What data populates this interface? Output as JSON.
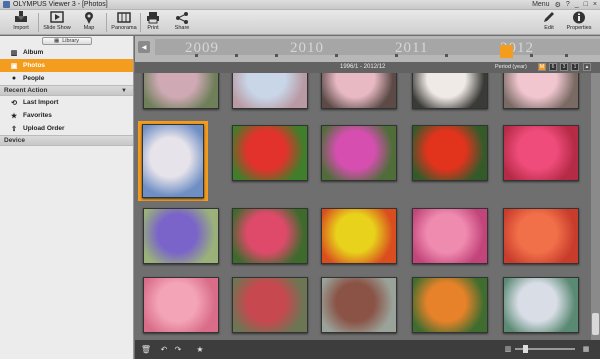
{
  "window": {
    "title": "OLYMPUS Viewer 3 - [Photos]",
    "menu_label": "Menu",
    "controls": [
      "⚙",
      "?",
      "_",
      "□",
      "×"
    ]
  },
  "toolbar": {
    "import": "Import",
    "slideshow": "Slide Show",
    "map": "Map",
    "panorama": "Panorama",
    "print": "Print",
    "share": "Share",
    "edit": "Edit",
    "properties": "Properties"
  },
  "library": {
    "button_label": "Library",
    "icon": "grid-icon"
  },
  "sidebar": {
    "items": [
      {
        "label": "Album",
        "icon": "album-icon",
        "selected": false
      },
      {
        "label": "Photos",
        "icon": "photos-icon",
        "selected": true
      },
      {
        "label": "People",
        "icon": "people-icon",
        "selected": false
      }
    ],
    "recent_header": "Recent Action",
    "recent_items": [
      {
        "label": "Last Import",
        "icon": "import-icon"
      },
      {
        "label": "Favorites",
        "icon": "star-icon"
      },
      {
        "label": "Upload Order",
        "icon": "upload-icon"
      }
    ],
    "device_header": "Device"
  },
  "timeline": {
    "years": [
      "2009",
      "2010",
      "2011",
      "2012"
    ],
    "range": "1996/1 - 2012/12",
    "period_label": "Period (year)",
    "period_buttons": [
      "M",
      "6",
      "3",
      "1"
    ],
    "active_button": 0
  },
  "photos": [
    {
      "subject": "cherry blossoms",
      "colors": [
        "#cfa9b4",
        "#6f7f5a"
      ]
    },
    {
      "subject": "cherry blossoms sky",
      "colors": [
        "#c8d6e8",
        "#b99aa4"
      ]
    },
    {
      "subject": "pink blossoms",
      "colors": [
        "#e8b9c3",
        "#5b4a46"
      ]
    },
    {
      "subject": "white blossoms",
      "colors": [
        "#f0eae6",
        "#3a3a36"
      ]
    },
    {
      "subject": "pink cherry",
      "colors": [
        "#f1c6cf",
        "#7a6a64"
      ]
    },
    {
      "subject": "tree in bloom",
      "colors": [
        "#e7e3ea",
        "#6f8fc4"
      ]
    },
    {
      "subject": "red tulip",
      "colors": [
        "#e3322b",
        "#3f7e2a"
      ]
    },
    {
      "subject": "pink orchid",
      "colors": [
        "#d64fb0",
        "#4e6d38"
      ]
    },
    {
      "subject": "red rose",
      "colors": [
        "#e2331d",
        "#355a2a"
      ]
    },
    {
      "subject": "pink orchid",
      "colors": [
        "#ef4c7b",
        "#b52a45"
      ]
    },
    {
      "subject": "lavender",
      "colors": [
        "#7a64c9",
        "#9ab27a"
      ]
    },
    {
      "subject": "pink lily",
      "colors": [
        "#e04a6a",
        "#3d6b2c"
      ]
    },
    {
      "subject": "yellow flower",
      "colors": [
        "#e8d21c",
        "#d94d1e"
      ]
    },
    {
      "subject": "pink dahlia",
      "colors": [
        "#f08bb0",
        "#c2447a"
      ]
    },
    {
      "subject": "orange flower",
      "colors": [
        "#f27049",
        "#c83c2c"
      ]
    },
    {
      "subject": "pink rose",
      "colors": [
        "#f4a4b7",
        "#d86c89"
      ]
    },
    {
      "subject": "flower garden",
      "colors": [
        "#c7494f",
        "#6c7654"
      ]
    },
    {
      "subject": "planter",
      "colors": [
        "#8a5346",
        "#9aa39a"
      ]
    },
    {
      "subject": "marigolds",
      "colors": [
        "#e8822a",
        "#3f6d2f"
      ]
    },
    {
      "subject": "white flower",
      "colors": [
        "#d8dde6",
        "#5b8a74"
      ]
    }
  ],
  "accent": "#f39c1d"
}
